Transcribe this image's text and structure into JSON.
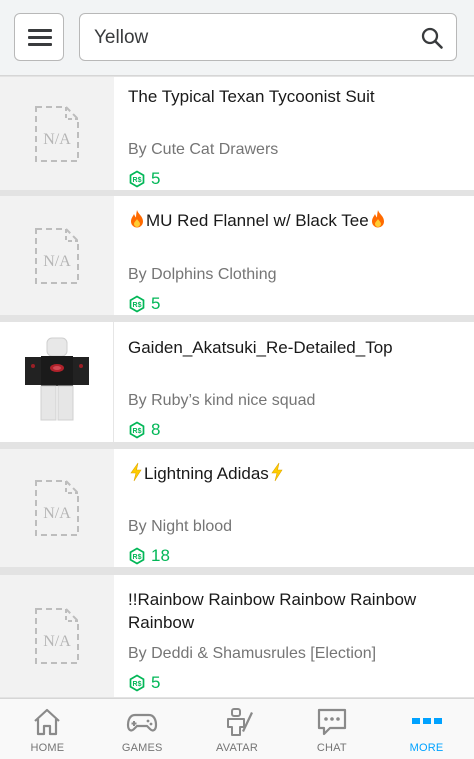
{
  "search": {
    "value": "Yellow"
  },
  "items": [
    {
      "name": "The Typical Texan Tycoonist Suit",
      "creator": "By Cute Cat Drawers",
      "price": "5",
      "thumbnail": "N/A"
    },
    {
      "name": "MU Red Flannel w/ Black Tee",
      "creator": "By Dolphins Clothing",
      "price": "5",
      "thumbnail": "N/A",
      "prefix_icon": "fire-emoji",
      "suffix_icon": "fire-emoji"
    },
    {
      "name": "Gaiden_Akatsuki_Re-Detailed_Top",
      "creator": "By Ruby’s kind nice squad",
      "price": "8",
      "thumbnail": "avatar-image"
    },
    {
      "name": "Lightning Adidas",
      "creator": "By Night blood",
      "price": "18",
      "thumbnail": "N/A",
      "prefix_icon": "lightning-emoji",
      "suffix_icon": "lightning-emoji"
    },
    {
      "name": "!!Rainbow Rainbow Rainbow Rainbow Rainbow",
      "creator": "By Deddi & Shamusrules [Election]",
      "price": "5",
      "thumbnail": "N/A"
    }
  ],
  "nav": {
    "home": "HOME",
    "games": "GAMES",
    "avatar": "AVATAR",
    "chat": "CHAT",
    "more": "MORE"
  },
  "colors": {
    "price": "#02b757",
    "active": "#00a2ff",
    "fire": "#ff6a00",
    "lightning": "#ffcc00"
  }
}
